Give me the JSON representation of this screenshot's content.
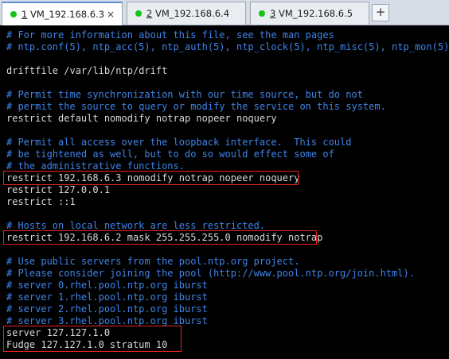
{
  "tabs": [
    {
      "num": "1",
      "name": " VM_192.168.6.3",
      "active": true
    },
    {
      "num": "2",
      "name": " VM_192.168.6.4",
      "active": false
    },
    {
      "num": "3",
      "name": " VM_192.168.6.5",
      "active": false
    }
  ],
  "add_tab_label": "+",
  "close_glyph": "×",
  "status_color": "#17c317",
  "highlight_color": "#e8241e",
  "lines": [
    {
      "text": "# For more information about this file, see the man pages",
      "type": "comment"
    },
    {
      "text": "# ntp.conf(5), ntp_acc(5), ntp_auth(5), ntp_clock(5), ntp_misc(5), ntp_mon(5).",
      "type": "comment"
    },
    {
      "text": "",
      "type": "blank"
    },
    {
      "text": "driftfile /var/lib/ntp/drift",
      "type": "text"
    },
    {
      "text": "",
      "type": "blank"
    },
    {
      "text": "# Permit time synchronization with our time source, but do not",
      "type": "comment"
    },
    {
      "text": "# permit the source to query or modify the service on this system.",
      "type": "comment"
    },
    {
      "text": "restrict default nomodify notrap nopeer noquery",
      "type": "text"
    },
    {
      "text": "",
      "type": "blank"
    },
    {
      "text": "# Permit all access over the loopback interface.  This could",
      "type": "comment"
    },
    {
      "text": "# be tightened as well, but to do so would effect some of",
      "type": "comment"
    },
    {
      "text": "# the administrative functions.",
      "type": "comment"
    },
    {
      "text": "restrict 192.168.6.3 nomodify notrap nopeer noquery",
      "type": "text"
    },
    {
      "text": "restrict 127.0.0.1",
      "type": "text"
    },
    {
      "text": "restrict ::1",
      "type": "text"
    },
    {
      "text": "",
      "type": "blank"
    },
    {
      "text": "# Hosts on local network are less restricted.",
      "type": "comment"
    },
    {
      "text": "restrict 192.168.6.2 mask 255.255.255.0 nomodify notrap",
      "type": "text"
    },
    {
      "text": "",
      "type": "blank"
    },
    {
      "text": "# Use public servers from the pool.ntp.org project.",
      "type": "comment"
    },
    {
      "text": "# Please consider joining the pool (http://www.pool.ntp.org/join.html).",
      "type": "comment"
    },
    {
      "text": "# server 0.rhel.pool.ntp.org iburst",
      "type": "comment"
    },
    {
      "text": "# server 1.rhel.pool.ntp.org iburst",
      "type": "comment"
    },
    {
      "text": "# server 2.rhel.pool.ntp.org iburst",
      "type": "comment"
    },
    {
      "text": "# server 3.rhel.pool.ntp.org iburst",
      "type": "comment"
    },
    {
      "text": "server 127.127.1.0",
      "type": "text"
    },
    {
      "text": "Fudge 127.127.1.0 stratum 10",
      "type": "text"
    }
  ]
}
